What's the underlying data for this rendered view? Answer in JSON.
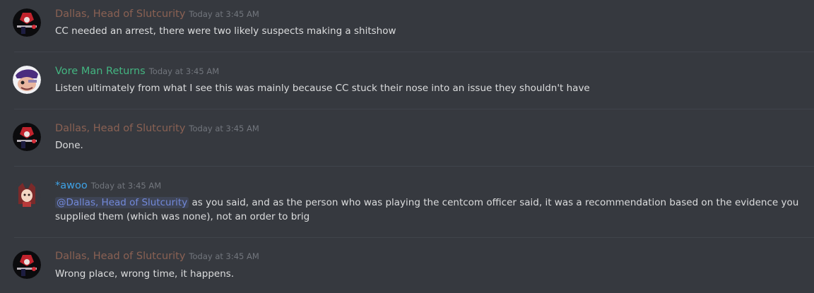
{
  "colors": {
    "role_brown": "#8a6153",
    "role_green": "#43b581",
    "role_blue": "#3ea2e6",
    "timestamp": "#72767d",
    "text": "#dcddde",
    "background": "#36393f"
  },
  "messages": [
    {
      "author": "Dallas, Head of Slutcurity",
      "timestamp": "Today at 3:45 AM",
      "text": "CC needed an arrest, there were two likely suspects making a shitshow"
    },
    {
      "author": "Vore Man Returns",
      "timestamp": "Today at 3:45 AM",
      "text": "Listen ultimately from what I see this was mainly because CC stuck their nose into an issue they shouldn't have"
    },
    {
      "author": "Dallas, Head of Slutcurity",
      "timestamp": "Today at 3:45 AM",
      "text": "Done."
    },
    {
      "author": "*awoo",
      "timestamp": "Today at 3:45 AM",
      "mention": "@Dallas, Head of Slutcurity",
      "text": " as you said, and as the person who was playing the centcom officer said, it was a recommendation based on the evidence you supplied them (which was none), not an order to brig"
    },
    {
      "author": "Dallas, Head of Slutcurity",
      "timestamp": "Today at 3:45 AM",
      "text": "Wrong place, wrong time, it happens."
    }
  ]
}
